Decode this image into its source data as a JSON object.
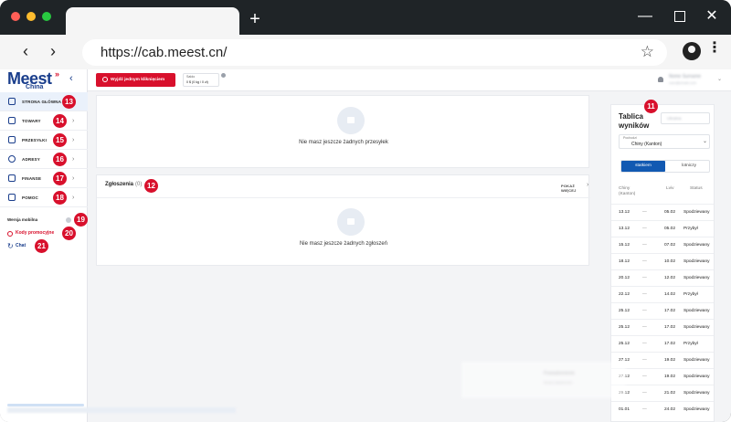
{
  "browser": {
    "url": "https://cab.meest.cn/",
    "icons": {
      "back": "arrow-left-icon",
      "forward": "arrow-right-icon",
      "new_tab": "plus-icon",
      "bookmark": "star-icon",
      "profile": "account-icon",
      "menu": "kebab-icon",
      "minimize": "minimize-icon",
      "maximize": "maximize-icon",
      "close": "close-icon"
    },
    "colors": {
      "chrome": "#1f2427",
      "toolbar": "#f5f5f5",
      "dot_red": "#ff5f57",
      "dot_yellow": "#febc2e",
      "dot_green": "#28c840"
    }
  },
  "brand": {
    "name": "Meest",
    "sup": "»",
    "sub": "China",
    "color": "#1a3e8c",
    "accent": "#d8102c"
  },
  "sidebar": {
    "items": [
      {
        "label": "STRONA GŁÓWNA",
        "icon": "grid-icon",
        "badge": "13"
      },
      {
        "label": "TOWARY",
        "icon": "bag-icon",
        "badge": "14"
      },
      {
        "label": "PRZESYŁKI",
        "icon": "box-icon",
        "badge": "15"
      },
      {
        "label": "ADRESY",
        "icon": "location-icon",
        "badge": "16"
      },
      {
        "label": "FINANSE",
        "icon": "wallet-icon",
        "badge": "17"
      },
      {
        "label": "POMOC",
        "icon": "chat-bubble-icon",
        "badge": "18"
      }
    ],
    "mobile_label": "Wersja mobilna",
    "mobile_badge": "19",
    "promo_label": "Kody promocyjne",
    "promo_badge": "20",
    "chat_label": "Chat",
    "chat_badge": "21"
  },
  "header": {
    "exit_label": "Wyjdź jednym kliknięciem",
    "balance_label": "Saldo",
    "balance_value": "0 $ (0 kg / 0 zł)",
    "user_name": "Nome Surname",
    "user_sub": "user@email.com"
  },
  "shipments": {
    "empty_text": "Nie masz jeszcze żadnych przesyłek"
  },
  "tickets": {
    "title": "Zgłoszenia",
    "count": "(0)",
    "badge": "12",
    "show_more": "POKAŻ WIĘCEJ",
    "empty_text": "Nie masz jeszcze żadnych zgłoszeń"
  },
  "results": {
    "title": "Tablica wyników",
    "badge": "11",
    "select_placeholder": "Ukraina",
    "origin_label": "Pochodzi",
    "origin_value": "Chiny (Kanton)",
    "toggle_on": "statkiem",
    "toggle_off": "lotniczy",
    "col_from": "Chiny (Kanton)",
    "col_to": "Lviv",
    "col_status": "Status",
    "rows": [
      {
        "from": "13.12",
        "to": "05.02",
        "status": "Spodziewany"
      },
      {
        "from": "13.12",
        "to": "05.02",
        "status": "Przybył"
      },
      {
        "from": "15.12",
        "to": "07.02",
        "status": "Spodziewany"
      },
      {
        "from": "18.12",
        "to": "10.02",
        "status": "Spodziewany"
      },
      {
        "from": "20.12",
        "to": "12.02",
        "status": "Spodziewany"
      },
      {
        "from": "22.12",
        "to": "14.02",
        "status": "Przybył"
      },
      {
        "from": "25.12",
        "to": "17.02",
        "status": "Spodziewany"
      },
      {
        "from": "25.12",
        "to": "17.02",
        "status": "Spodziewany"
      },
      {
        "from": "25.12",
        "to": "17.02",
        "status": "Przybył"
      },
      {
        "from": "27.12",
        "to": "19.02",
        "status": "Spodziewany"
      },
      {
        "from": "27.12",
        "to": "19.02",
        "status": "Spodziewany"
      },
      {
        "from": "29.12",
        "to": "21.02",
        "status": "Spodziewany"
      },
      {
        "from": "01.01",
        "to": "24.02",
        "status": "Spodziewany"
      }
    ],
    "dash": "—"
  },
  "toast": {
    "line1": "Powiadomienie",
    "line2": "Nowa wiadomość"
  }
}
